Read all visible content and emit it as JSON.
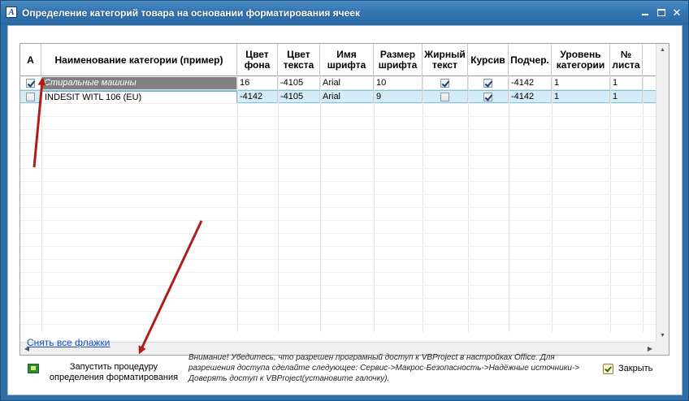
{
  "window": {
    "title": "Определение категорий товара на основании форматирования ячеек",
    "app_icon": "A"
  },
  "grid": {
    "columns": [
      {
        "key": "A",
        "label": "A"
      },
      {
        "key": "name",
        "label": "Наименование категории (пример)"
      },
      {
        "key": "bg",
        "label": "Цвет\nфона"
      },
      {
        "key": "fg",
        "label": "Цвет\nтекста"
      },
      {
        "key": "font",
        "label": "Имя\nшрифта"
      },
      {
        "key": "size",
        "label": "Размер\nшрифта"
      },
      {
        "key": "bold",
        "label": "Жирный\nтекст"
      },
      {
        "key": "italic",
        "label": "Курсив"
      },
      {
        "key": "underline",
        "label": "Подчер."
      },
      {
        "key": "level",
        "label": "Уровень\nкатегории"
      },
      {
        "key": "sheet",
        "label": "№\nлиста"
      }
    ],
    "rows": [
      {
        "checked": true,
        "name": "Стиральные машины",
        "bg": "16",
        "fg": "-4105",
        "font": "Arial",
        "size": "10",
        "bold": true,
        "italic": true,
        "underline": "-4142",
        "level": "1",
        "sheet": "1"
      },
      {
        "checked": false,
        "name": "INDESIT WITL 106 (EU)",
        "bg": "-4142",
        "fg": "-4105",
        "font": "Arial",
        "size": "9",
        "bold": false,
        "italic": true,
        "underline": "-4142",
        "level": "1",
        "sheet": "1"
      }
    ]
  },
  "footer": {
    "uncheck_all": "Снять все флажки",
    "run_button": "Запустить процедуру\nопределения форматирования",
    "note": "Внимание! Убедитесь, что разрешен програмный доступ к VBProject в настройках Office. Для разрешения доступа сделайте следующее: Сервис->Макрос-Безопасность->Надёжные источники-> Доверять доступ к VBProject(установите галочку).",
    "close_button": "Закрыть"
  },
  "icons": {
    "run": "excel-run-icon",
    "close": "close-check-icon",
    "annotation": "red-arrow-icon"
  },
  "colors": {
    "titlebar": "#3476b3",
    "selected_row": "#d4ecf7",
    "sample_bg": "#808080",
    "link": "#1a4ec2",
    "annotation_arrow": "#b01c1c"
  }
}
